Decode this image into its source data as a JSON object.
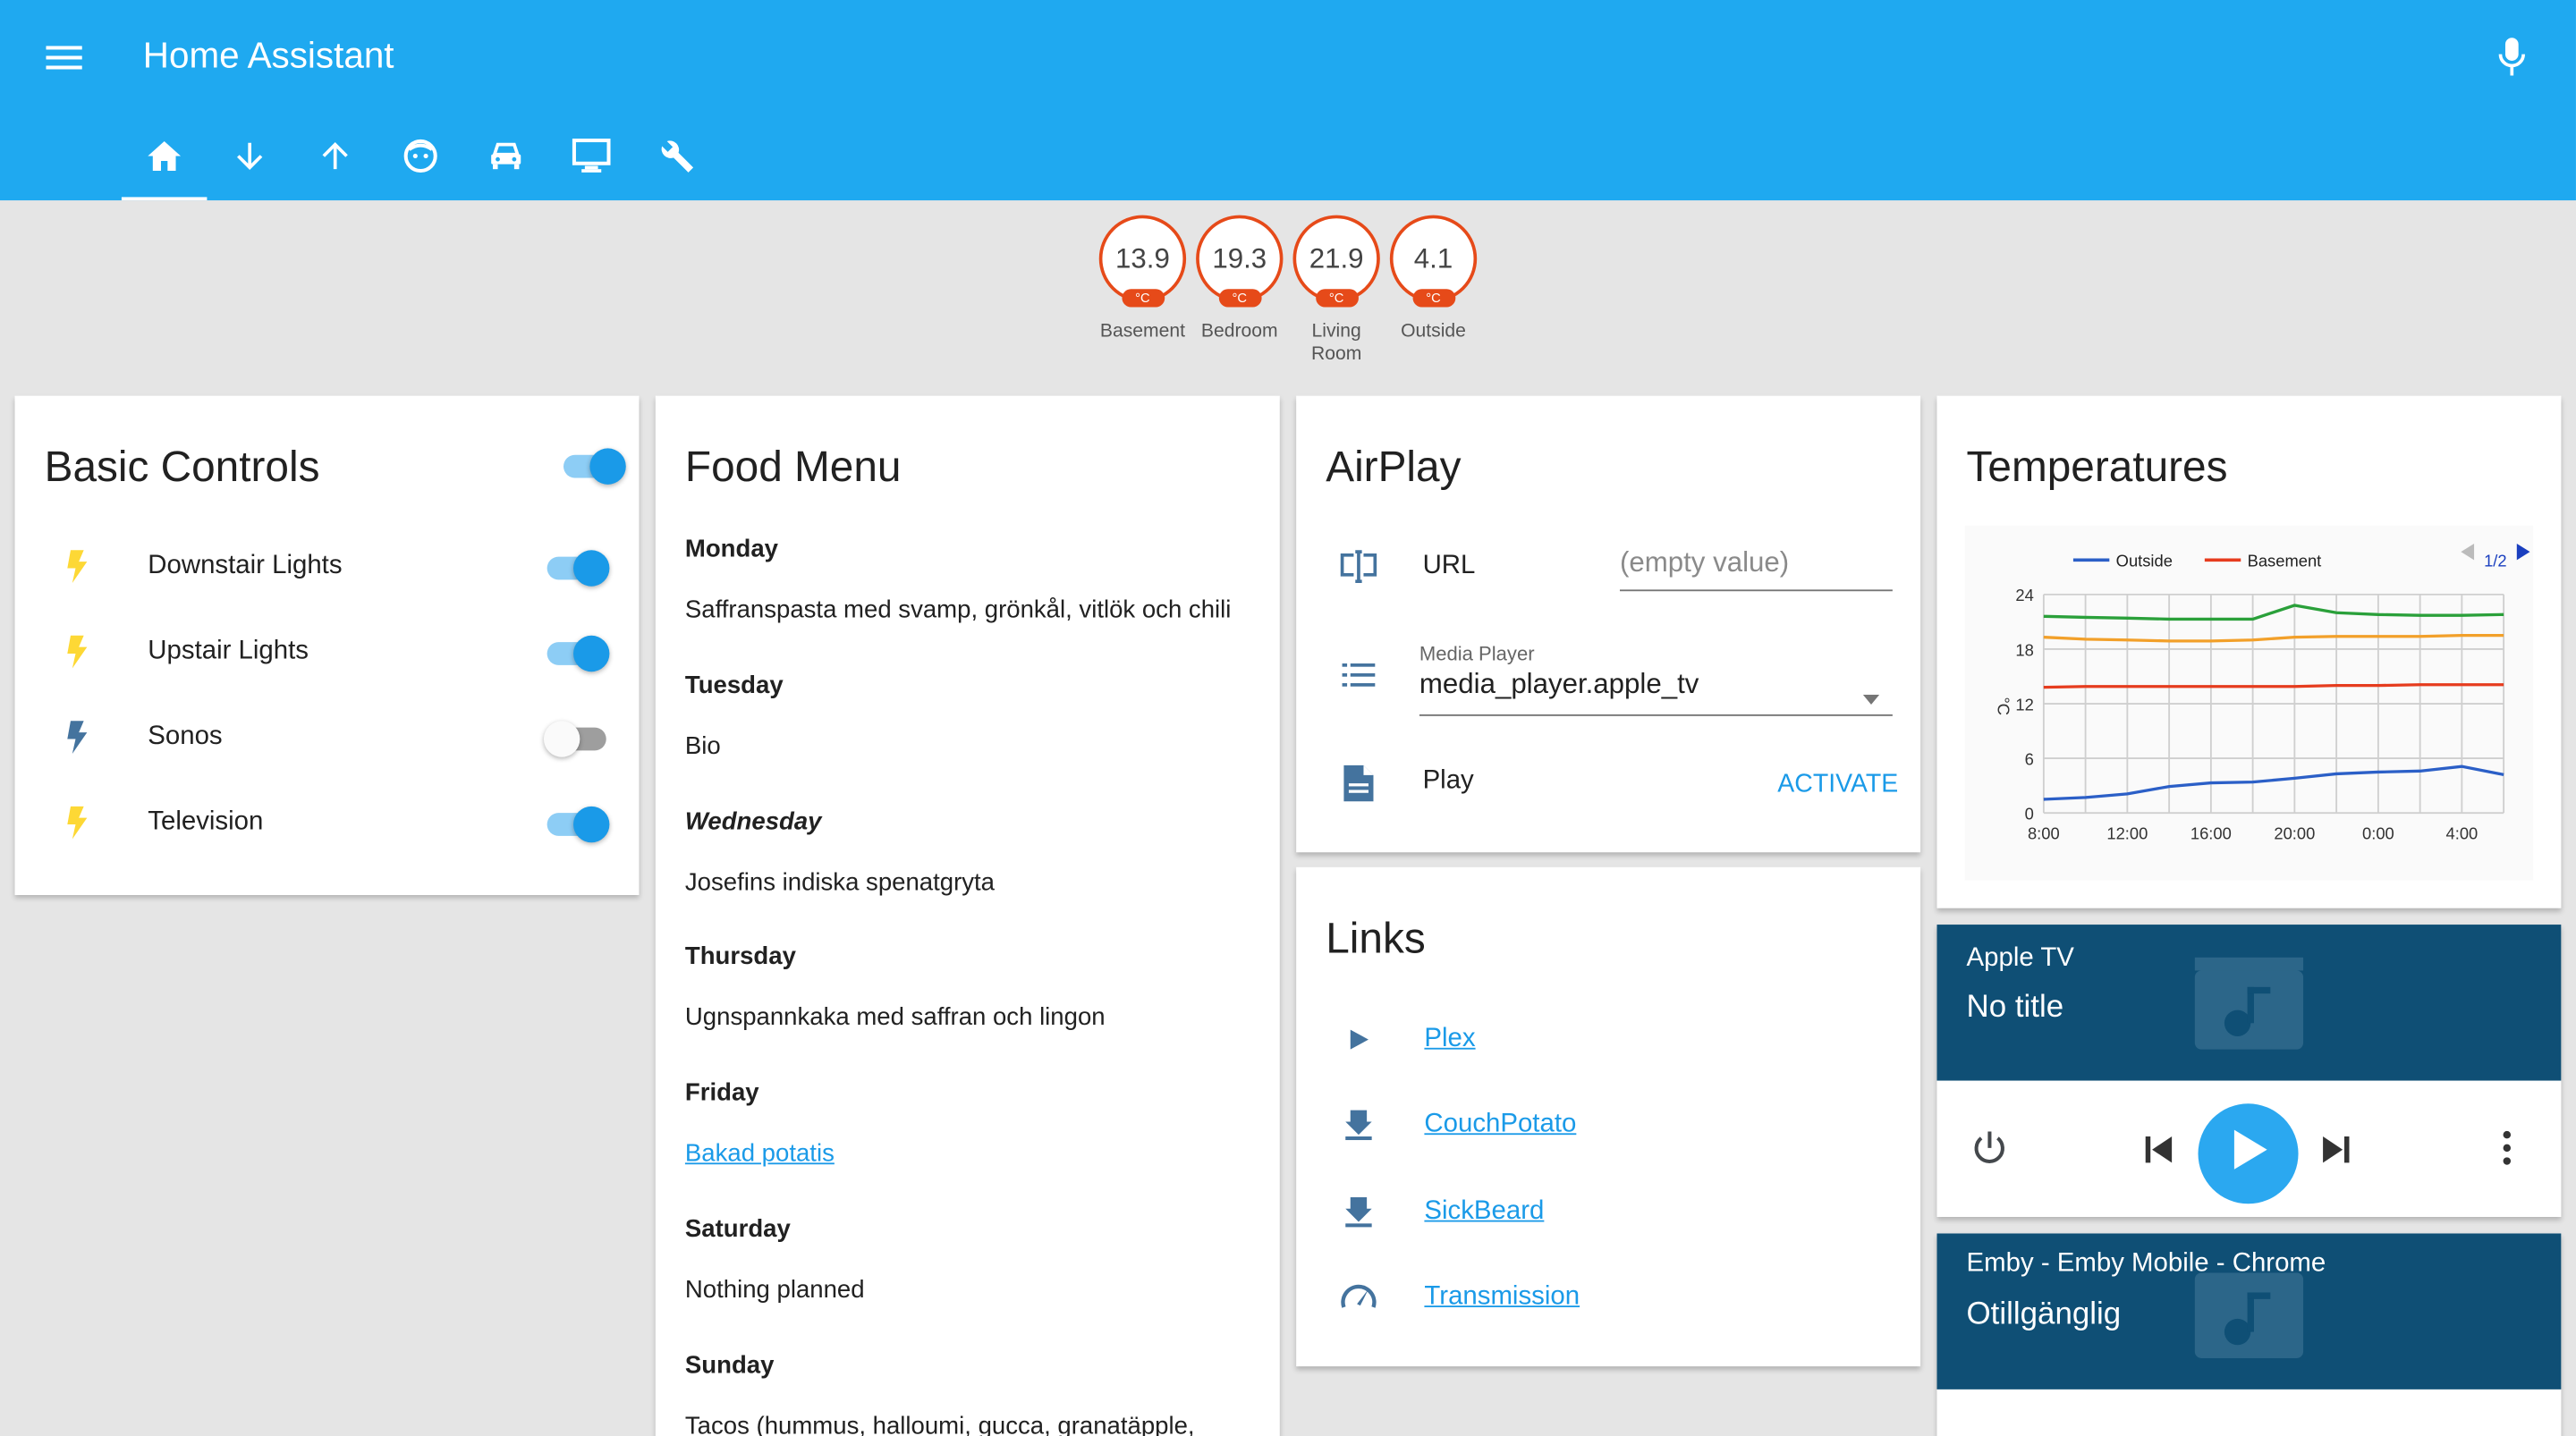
{
  "header": {
    "title": "Home Assistant",
    "menu_icon": "menu-icon",
    "mic_icon": "microphone-icon"
  },
  "tabs": [
    {
      "icon": "home-icon",
      "active": true
    },
    {
      "icon": "arrow-down-icon"
    },
    {
      "icon": "arrow-up-icon"
    },
    {
      "icon": "face-icon"
    },
    {
      "icon": "car-icon"
    },
    {
      "icon": "monitor-icon"
    },
    {
      "icon": "wrench-icon"
    }
  ],
  "badges": [
    {
      "value": "13.9",
      "unit": "°C",
      "label": "Basement"
    },
    {
      "value": "19.3",
      "unit": "°C",
      "label": "Bedroom"
    },
    {
      "value": "21.9",
      "unit": "°C",
      "label": "Living Room"
    },
    {
      "value": "4.1",
      "unit": "°C",
      "label": "Outside"
    }
  ],
  "basic_controls": {
    "title": "Basic Controls",
    "master_on": true,
    "items": [
      {
        "label": "Downstair Lights",
        "on": true
      },
      {
        "label": "Upstair Lights",
        "on": true
      },
      {
        "label": "Sonos",
        "on": false
      },
      {
        "label": "Television",
        "on": true
      }
    ]
  },
  "food_menu": {
    "title": "Food Menu",
    "days": [
      {
        "day": "Monday",
        "meal": "Saffranspasta med svamp, grönkål, vitlök och chili"
      },
      {
        "day": "Tuesday",
        "meal": "Bio"
      },
      {
        "day": "Wednesday",
        "meal": "Josefins indiska spenatgryta"
      },
      {
        "day": "Thursday",
        "meal": "Ugnspannkaka med saffran och lingon"
      },
      {
        "day": "Friday",
        "meal": "Bakad potatis"
      },
      {
        "day": "Saturday",
        "meal": "Nothing planned"
      },
      {
        "day": "Sunday",
        "meal": "Tacos (hummus, halloumi, gucca, granatäpple,"
      }
    ]
  },
  "airplay": {
    "title": "AirPlay",
    "url_label": "URL",
    "url_placeholder": "(empty value)",
    "media_player_label": "Media Player",
    "media_player_value": "media_player.apple_tv",
    "play_label": "Play",
    "activate_label": "ACTIVATE"
  },
  "links": {
    "title": "Links",
    "items": [
      {
        "label": "Plex",
        "icon": "play-icon"
      },
      {
        "label": "CouchPotato",
        "icon": "download-icon"
      },
      {
        "label": "SickBeard",
        "icon": "download-icon"
      },
      {
        "label": "Transmission",
        "icon": "speedometer-icon"
      }
    ]
  },
  "temperatures": {
    "title": "Temperatures",
    "legend_page": "1/2"
  },
  "chart_data": {
    "type": "line",
    "title": "",
    "xlabel": "",
    "ylabel": "°C",
    "x": [
      "8:00",
      "10:00",
      "12:00",
      "14:00",
      "16:00",
      "18:00",
      "20:00",
      "22:00",
      "0:00",
      "2:00",
      "4:00",
      "6:00"
    ],
    "xticks": [
      "8:00",
      "12:00",
      "16:00",
      "20:00",
      "0:00",
      "4:00"
    ],
    "yticks": [
      0,
      6,
      12,
      18,
      24
    ],
    "ylim": [
      0,
      24
    ],
    "grid": true,
    "legend": "top",
    "series": [
      {
        "name": "Outside",
        "color": "#2b5fc7",
        "values": [
          1.5,
          1.7,
          2.1,
          2.9,
          3.3,
          3.4,
          3.8,
          4.3,
          4.5,
          4.6,
          5.1,
          4.2
        ]
      },
      {
        "name": "Basement",
        "color": "#e63c1e",
        "values": [
          13.8,
          13.9,
          13.9,
          13.9,
          13.9,
          13.9,
          13.9,
          14.0,
          14.0,
          14.1,
          14.1,
          14.1
        ]
      },
      {
        "name": "",
        "color": "#f2a02a",
        "values": [
          19.3,
          19.1,
          19.0,
          18.9,
          18.9,
          19.0,
          19.3,
          19.4,
          19.4,
          19.4,
          19.5,
          19.5
        ]
      },
      {
        "name": "",
        "color": "#2aa03a",
        "values": [
          21.6,
          21.5,
          21.4,
          21.3,
          21.3,
          21.3,
          22.8,
          22.0,
          21.8,
          21.7,
          21.7,
          21.8
        ]
      }
    ]
  },
  "media_apple_tv": {
    "name": "Apple TV",
    "state": "No title"
  },
  "media_emby": {
    "name": "Emby - Emby Mobile - Chrome",
    "state": "Otillgänglig"
  }
}
